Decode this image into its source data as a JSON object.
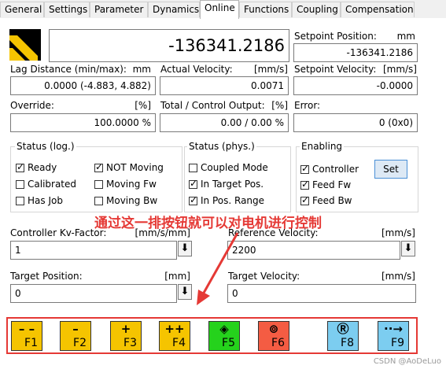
{
  "tabs": [
    "General",
    "Settings",
    "Parameter",
    "Dynamics",
    "Online",
    "Functions",
    "Coupling",
    "Compensation"
  ],
  "active_tab": "Online",
  "position_display": {
    "value": "-136341.2186"
  },
  "setpoint_position": {
    "label": "Setpoint Position:",
    "unit": "mm",
    "value": "-136341.2186"
  },
  "lag_distance": {
    "label": "Lag Distance (min/max):",
    "unit": "mm",
    "value": "0.0000  (-4.883, 4.882)"
  },
  "actual_velocity": {
    "label": "Actual Velocity:",
    "unit": "[mm/s]",
    "value": "0.0071"
  },
  "setpoint_velocity": {
    "label": "Setpoint Velocity:",
    "unit": "[mm/s]",
    "value": "-0.0000"
  },
  "override": {
    "label": "Override:",
    "unit": "[%]",
    "value": "100.0000 %"
  },
  "total_output": {
    "label": "Total / Control Output:",
    "unit": "[%]",
    "value": "0.00 /  0.00 %"
  },
  "error": {
    "label": "Error:",
    "value": "0 (0x0)"
  },
  "status_log": {
    "title": "Status (log.)",
    "items": [
      {
        "label": "Ready",
        "checked": true
      },
      {
        "label": "Calibrated",
        "checked": false
      },
      {
        "label": "Has Job",
        "checked": false
      },
      {
        "label": "NOT Moving",
        "checked": true
      },
      {
        "label": "Moving Fw",
        "checked": false
      },
      {
        "label": "Moving Bw",
        "checked": false
      }
    ]
  },
  "status_phys": {
    "title": "Status (phys.)",
    "items": [
      {
        "label": "Coupled Mode",
        "checked": false
      },
      {
        "label": "In Target Pos.",
        "checked": true
      },
      {
        "label": "In Pos. Range",
        "checked": true
      }
    ]
  },
  "enabling": {
    "title": "Enabling",
    "items": [
      {
        "label": "Controller",
        "checked": true
      },
      {
        "label": "Feed Fw",
        "checked": true
      },
      {
        "label": "Feed Bw",
        "checked": true
      }
    ],
    "set_label": "Set"
  },
  "annotation": "通过这一排按钮就可以对电机进行控制",
  "kv_factor": {
    "label": "Controller Kv-Factor:",
    "unit": "[mm/s/mm]",
    "value": "1"
  },
  "reference_velocity": {
    "label": "Reference Velocity:",
    "unit": "[mm/s]",
    "value": "2200"
  },
  "target_position": {
    "label": "Target Position:",
    "unit": "[mm]",
    "value": "0"
  },
  "target_velocity": {
    "label": "Target Velocity:",
    "unit": "[mm/s]",
    "value": "0"
  },
  "function_keys": [
    {
      "symbol": "– –",
      "label": "F1",
      "color": "#f5c400"
    },
    {
      "symbol": "–",
      "label": "F2",
      "color": "#f5c400"
    },
    {
      "symbol": "+",
      "label": "F3",
      "color": "#f5c400"
    },
    {
      "symbol": "++",
      "label": "F4",
      "color": "#f5c400"
    },
    {
      "symbol": "◈",
      "label": "F5",
      "color": "#25d21c"
    },
    {
      "symbol": "⊚",
      "label": "F6",
      "color": "#f45c43"
    },
    {
      "symbol": "Ⓡ",
      "label": "F8",
      "color": "#7ccdf0"
    },
    {
      "symbol": "··→",
      "label": "F9",
      "color": "#7ccdf0"
    }
  ],
  "watermark": "CSDN @AoDeLuo",
  "colors": {
    "annotation": "#e53935",
    "highlight_border": "#e53935",
    "set_button": "#dde9f5"
  }
}
